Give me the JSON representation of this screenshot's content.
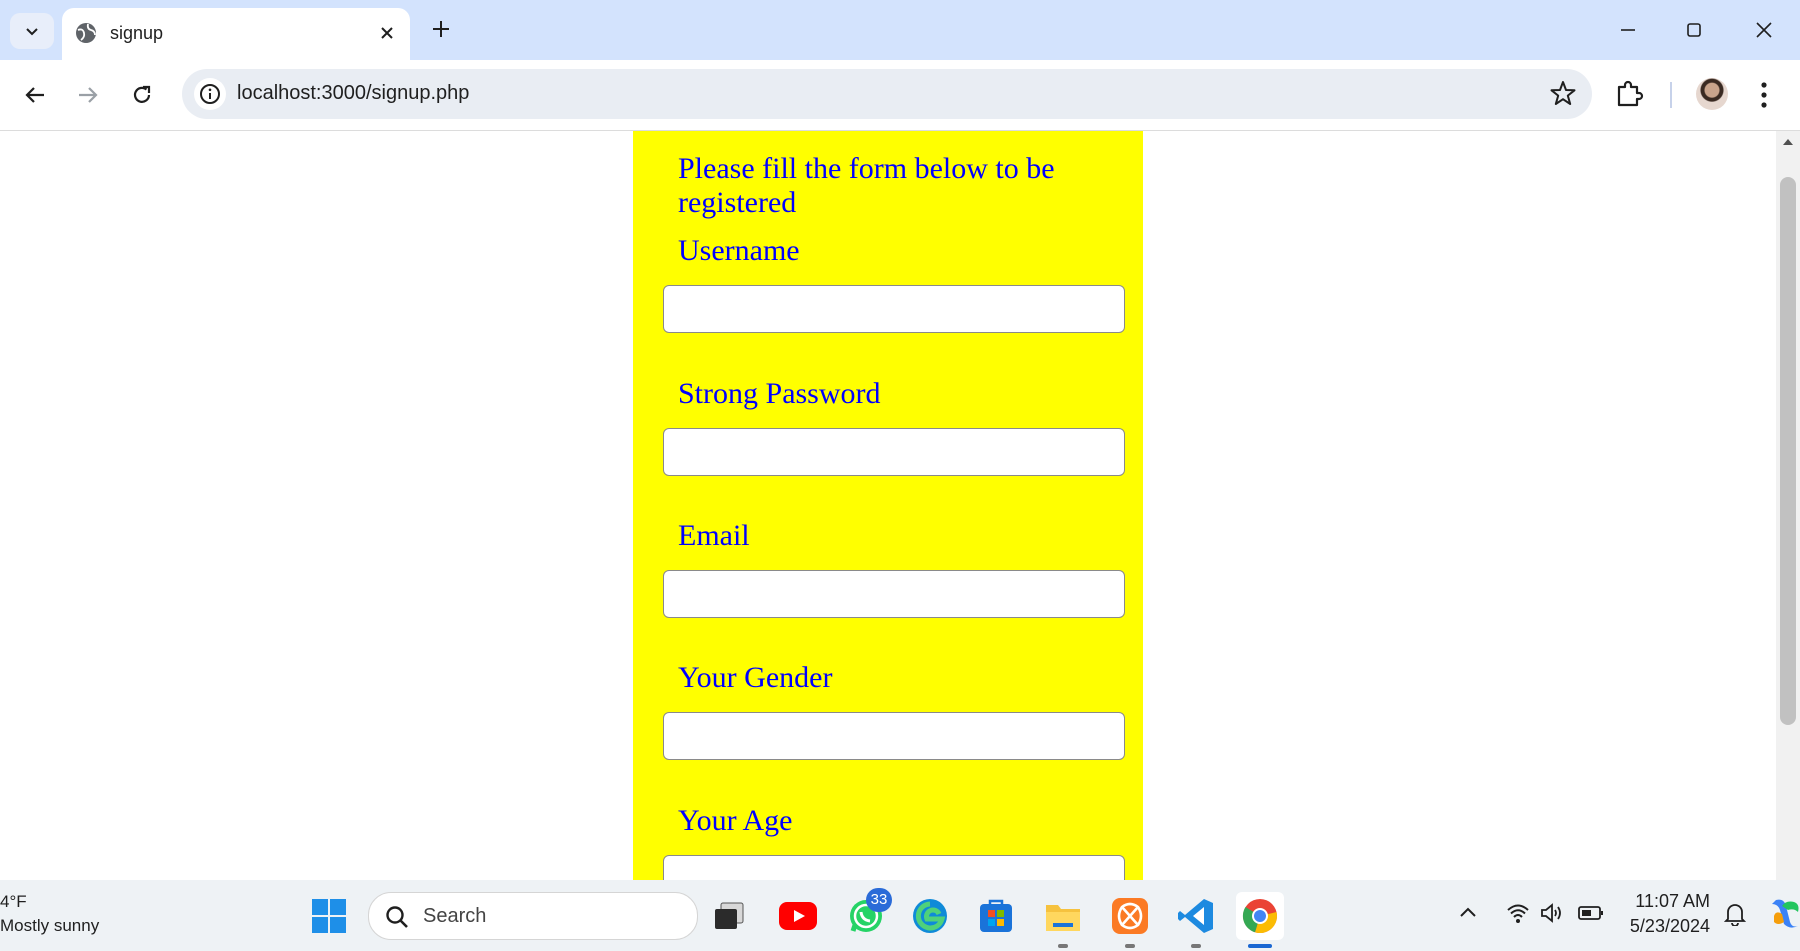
{
  "browser": {
    "tab_title": "signup",
    "url": "localhost:3000/signup.php"
  },
  "form": {
    "intro": "Please fill the form below to be registered",
    "fields": [
      {
        "label": "Username",
        "value": ""
      },
      {
        "label": "Strong Password",
        "value": ""
      },
      {
        "label": "Email",
        "value": ""
      },
      {
        "label": "Your Gender",
        "value": ""
      },
      {
        "label": "Your Age",
        "value": ""
      }
    ],
    "panel_color": "#ffff00",
    "text_color": "#0000ff"
  },
  "taskbar": {
    "weather_temp": "4°F",
    "weather_desc": "Mostly sunny",
    "search_placeholder": "Search",
    "whatsapp_badge": "33",
    "time": "11:07 AM",
    "date": "5/23/2024",
    "apps": [
      "task-view",
      "youtube",
      "whatsapp",
      "edge",
      "microsoft-store",
      "file-explorer",
      "xampp",
      "vscode",
      "chrome"
    ]
  }
}
